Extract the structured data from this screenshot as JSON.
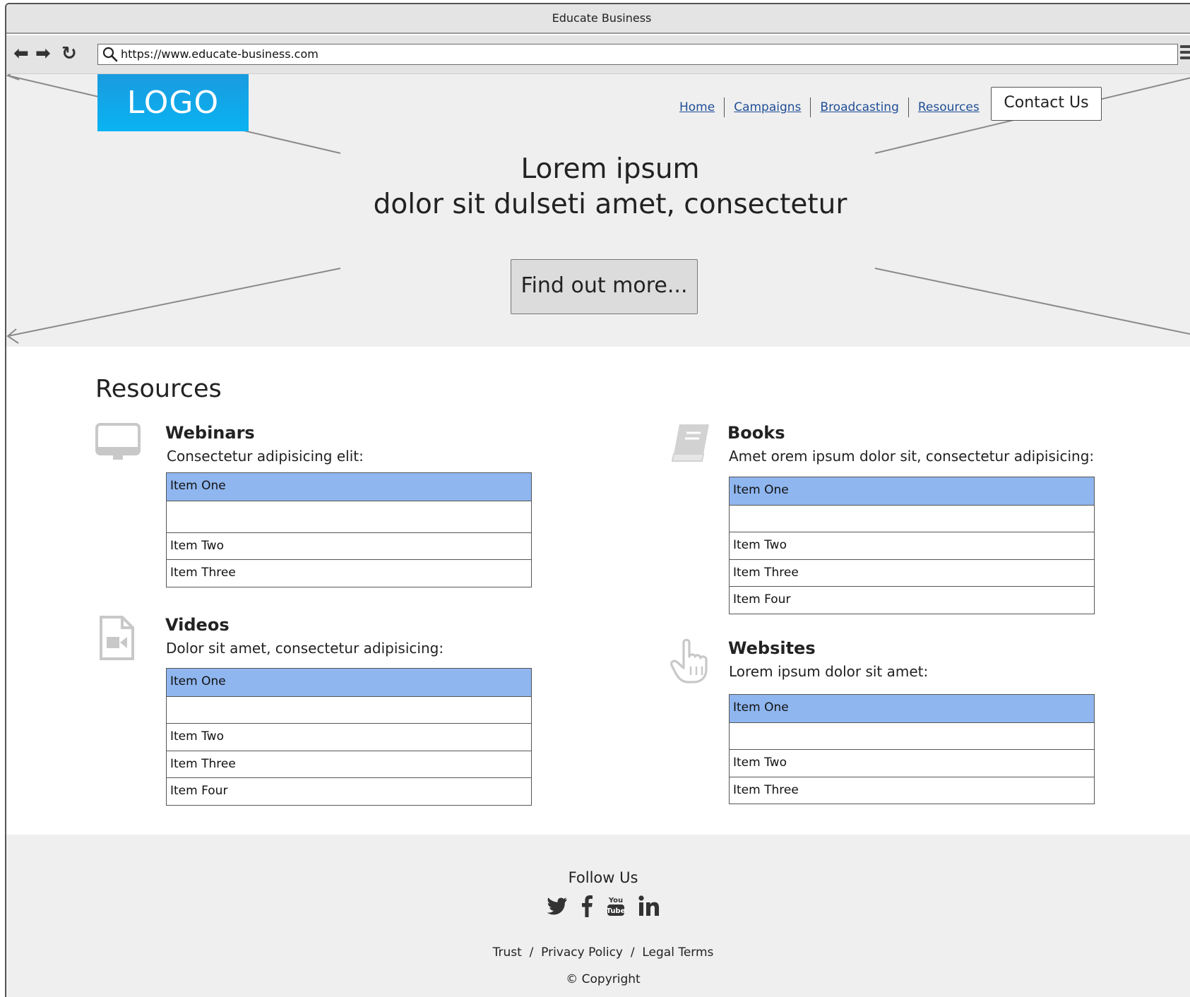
{
  "window": {
    "title": "Educate Business"
  },
  "browser": {
    "url": "https://www.educate-business.com",
    "back_icon": "arrow-left-icon",
    "forward_icon": "arrow-right-icon",
    "reload_icon": "reload-icon",
    "menu_icon": "hamburger-menu-icon"
  },
  "header": {
    "logo": "LOGO",
    "nav": [
      "Home",
      "Campaigns",
      "Broadcasting",
      "Resources"
    ],
    "contact_label": "Contact Us"
  },
  "hero": {
    "title_line1": "Lorem ipsum",
    "title_line2": "dolor sit dulseti amet, consectetur",
    "cta_label": "Find out more..."
  },
  "resources": {
    "heading": "Resources",
    "sections": [
      {
        "key": "webinars",
        "title": "Webinars",
        "icon": "monitor-icon",
        "description": "Consectetur adipisicing elit:",
        "items": [
          "Item One",
          "",
          "Item Two",
          "Item Three"
        ],
        "selected": 0
      },
      {
        "key": "books",
        "title": "Books",
        "icon": "book-icon",
        "description": "Amet orem ipsum dolor sit, consectetur adipisicing:",
        "items": [
          "Item One",
          "",
          "Item Two",
          "Item Three",
          "Item Four"
        ],
        "selected": 0
      },
      {
        "key": "videos",
        "title": "Videos",
        "icon": "video-file-icon",
        "description": "Dolor sit amet, consectetur adipisicing:",
        "items": [
          "Item One",
          "",
          "Item Two",
          "Item Three",
          "Item Four"
        ],
        "selected": 0
      },
      {
        "key": "websites",
        "title": "Websites",
        "icon": "pointing-hand-icon",
        "description": "Lorem ipsum dolor sit amet:",
        "items": [
          "Item One",
          "",
          "Item Two",
          "Item Three"
        ],
        "selected": 0
      }
    ]
  },
  "footer": {
    "follow_label": "Follow Us",
    "social_icons": [
      "twitter-icon",
      "facebook-icon",
      "youtube-icon",
      "linkedin-icon"
    ],
    "links": [
      "Trust",
      "Privacy Policy",
      "Legal Terms"
    ],
    "link_separator": "/",
    "copyright": "Copyright"
  },
  "colors": {
    "logo": "#0aa7ea",
    "selected_row": "#8fb6ef",
    "nav_link": "#1f4e96",
    "hero_bg": "#efefef"
  }
}
